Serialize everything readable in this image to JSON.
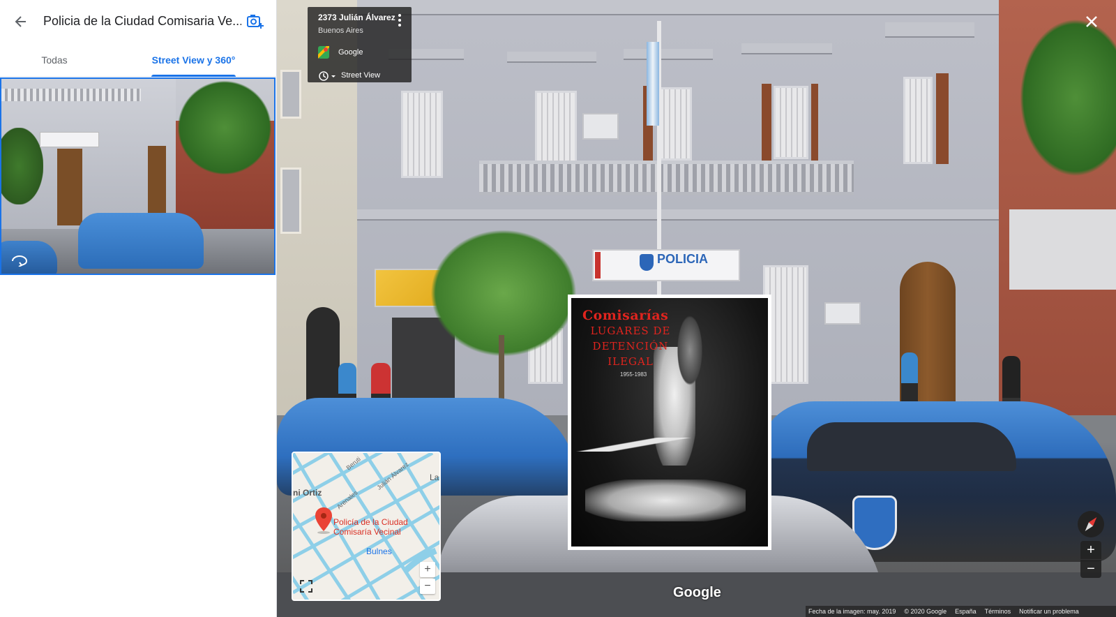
{
  "panel": {
    "title": "Policia de la Ciudad Comisaria Ve...",
    "tabs": [
      {
        "label": "Todas"
      },
      {
        "label": "Street View y 360°"
      }
    ]
  },
  "street_view": {
    "address_card": {
      "title": "2373 Julián Álvarez",
      "subtitle": "Buenos Aires",
      "source": "Google",
      "history_label": "Street View"
    },
    "storefront_text": "POLICIA",
    "google_logo": "Google"
  },
  "poster": {
    "title": "Comisarías",
    "line1": "LUGARES DE",
    "line2": "DETENCIÓN",
    "line3": "ILEGAL",
    "years": "1955-1983"
  },
  "minimap": {
    "place_line1": "Policía de la Ciudad",
    "place_line2": "Comisaría Vecinal",
    "street_labels": [
      "ni Ortiz",
      "Bulnes",
      "Julián Álvarez",
      "Beruti",
      "Arenales",
      "La"
    ],
    "zoom_in": "+",
    "zoom_out": "−"
  },
  "controls": {
    "zoom_in": "+",
    "zoom_out": "−"
  },
  "footer": {
    "date": "Fecha de la imagen: may. 2019",
    "copyright": "© 2020 Google",
    "country": "España",
    "terms": "Términos",
    "report": "Notificar un problema"
  },
  "colors": {
    "accent": "#1a73e8",
    "poster_red": "#e0241e",
    "police_blue": "#3a7fd0",
    "map_pin": "#ea4335"
  }
}
